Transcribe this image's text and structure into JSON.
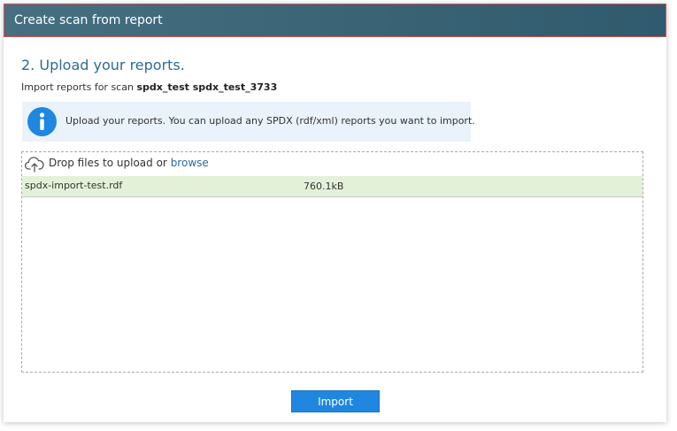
{
  "dialog": {
    "title": "Create scan from report"
  },
  "step": {
    "heading": "2. Upload your reports.",
    "subtitle_prefix": "Import reports for scan",
    "scan_name": "spdx_test spdx_test_3733"
  },
  "info": {
    "icon": "info-icon",
    "text": "Upload your reports. You can upload any SPDX (rdf/xml) reports you want to import."
  },
  "dropzone": {
    "icon": "cloud-upload-icon",
    "prompt": "Drop files to upload or",
    "browse_label": "browse",
    "files": [
      {
        "name": "spdx-import-test.rdf",
        "size": "760.1kB"
      }
    ]
  },
  "actions": {
    "import_label": "Import"
  },
  "colors": {
    "title_bar": "#3b6577",
    "title_border": "#d9534f",
    "heading": "#2d6b95",
    "info_bg": "#eaf2fb",
    "info_icon": "#1f87e0",
    "file_row_bg": "#e4f1d9",
    "button_bg": "#1f87e0"
  }
}
